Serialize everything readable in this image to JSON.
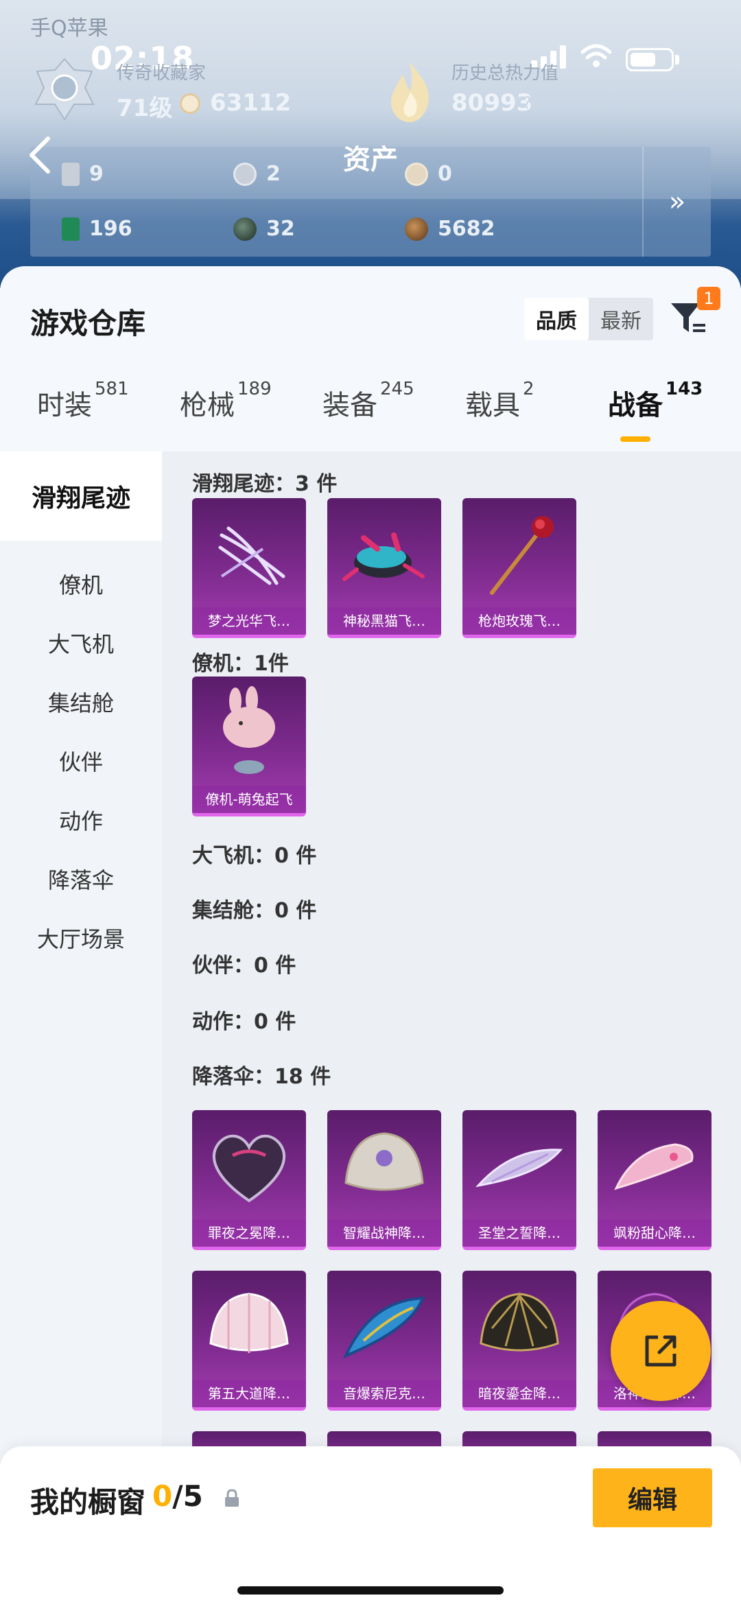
{
  "status_bar": {
    "carrier": "手Q苹果",
    "carrier_extra": "",
    "time": "02:18"
  },
  "profile": {
    "level_label": "传奇收藏家",
    "level": "71级",
    "coins": "63112",
    "heat_label": "历史总热力值",
    "heat": "80993",
    "heat_help": "?"
  },
  "header": {
    "title": "资产"
  },
  "assets": {
    "row1": [
      {
        "icon": "card-icon",
        "value": "9"
      },
      {
        "icon": "silver-coin-icon",
        "value": "2"
      },
      {
        "icon": "gold-coin-icon",
        "value": "0"
      }
    ],
    "row2": [
      {
        "icon": "green-card-icon",
        "value": "196"
      },
      {
        "icon": "orb-icon",
        "value": "32"
      },
      {
        "icon": "bronze-coin-icon",
        "value": "5682"
      }
    ],
    "more": "»"
  },
  "warehouse": {
    "title": "游戏仓库",
    "sort_quality": "品质",
    "sort_newest": "最新",
    "filter_badge": "1"
  },
  "tabs": [
    {
      "label": "时装",
      "count": "581"
    },
    {
      "label": "枪械",
      "count": "189"
    },
    {
      "label": "装备",
      "count": "245"
    },
    {
      "label": "载具",
      "count": "2"
    },
    {
      "label": "战备",
      "count": "143"
    }
  ],
  "sidebar": [
    "滑翔尾迹",
    "僚机",
    "大飞机",
    "集结舱",
    "伙伴",
    "动作",
    "降落伞",
    "大厅场景"
  ],
  "sections": {
    "trail": "滑翔尾迹：3 件",
    "wingman": "僚机：1件",
    "bigplane": "大飞机：0 件",
    "capsule": "集结舱：0 件",
    "partner": "伙伴：0 件",
    "action": "动作：0 件",
    "parachute": "降落伞：18 件"
  },
  "items": {
    "trail": [
      "梦之光华飞…",
      "神秘黑猫飞…",
      "枪炮玫瑰飞…"
    ],
    "wingman": [
      "僚机-萌兔起飞"
    ],
    "parachute_row1": [
      "罪夜之冕降…",
      "智耀战神降…",
      "圣堂之誓降…",
      "飒粉甜心降…"
    ],
    "parachute_row2": [
      "第五大道降…",
      "音爆索尼克…",
      "暗夜鎏金降…",
      "洛神大赋降…"
    ]
  },
  "bottom": {
    "label": "我的橱窗",
    "count_current": "0",
    "count_total": "/5",
    "edit": "编辑"
  }
}
